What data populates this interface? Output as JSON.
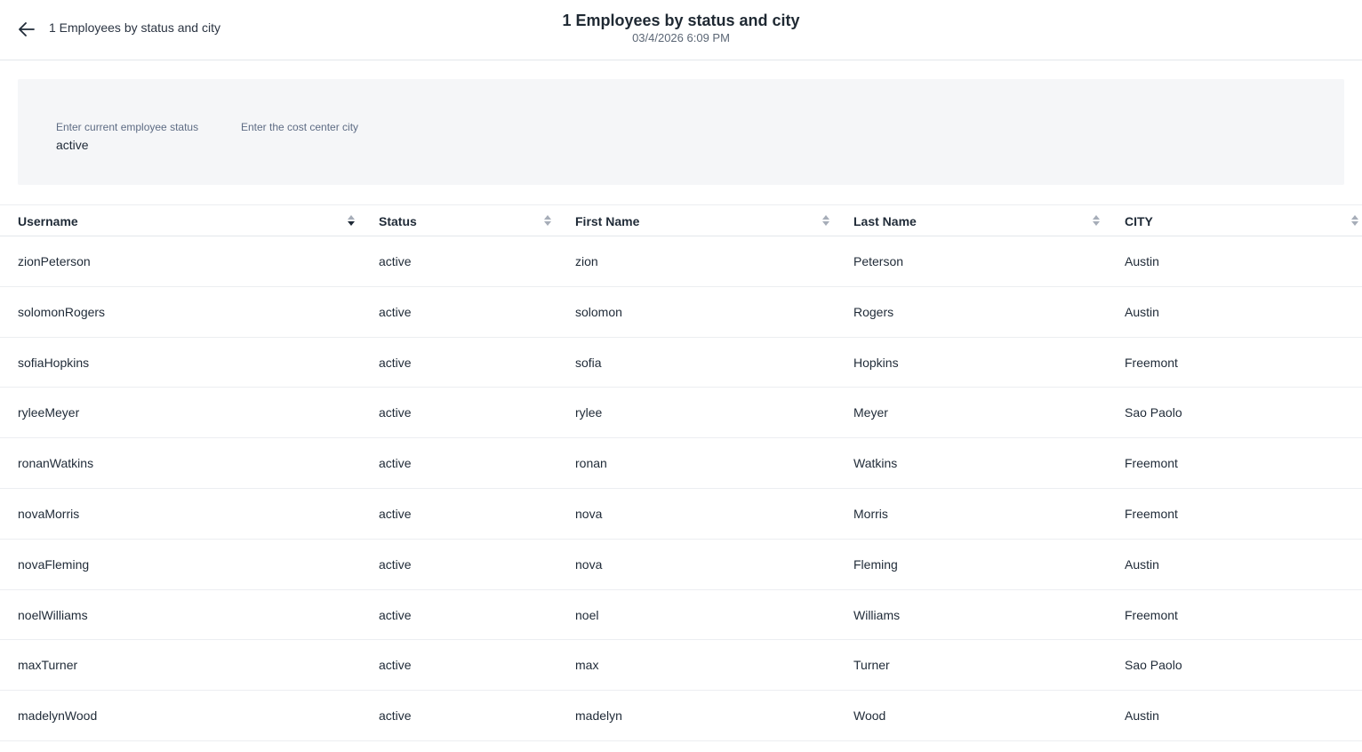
{
  "header": {
    "breadcrumb": "1 Employees by status and city",
    "title": "1 Employees by status and city",
    "timestamp": "03/4/2026 6:09 PM",
    "back_icon": "arrow-left-icon"
  },
  "filters": [
    {
      "label": "Enter current employee status",
      "value": "active"
    },
    {
      "label": "Enter the cost center city",
      "value": ""
    }
  ],
  "table": {
    "columns": [
      "Username",
      "Status",
      "First Name",
      "Last Name",
      "CITY"
    ],
    "sorted_column": "Username",
    "sort_direction": "descending",
    "rows": [
      [
        "zionPeterson",
        "active",
        "zion",
        "Peterson",
        "Austin"
      ],
      [
        "solomonRogers",
        "active",
        "solomon",
        "Rogers",
        "Austin"
      ],
      [
        "sofiaHopkins",
        "active",
        "sofia",
        "Hopkins",
        "Freemont"
      ],
      [
        "ryleeMeyer",
        "active",
        "rylee",
        "Meyer",
        "Sao Paolo"
      ],
      [
        "ronanWatkins",
        "active",
        "ronan",
        "Watkins",
        "Freemont"
      ],
      [
        "novaMorris",
        "active",
        "nova",
        "Morris",
        "Freemont"
      ],
      [
        "novaFleming",
        "active",
        "nova",
        "Fleming",
        "Austin"
      ],
      [
        "noelWilliams",
        "active",
        "noel",
        "Williams",
        "Freemont"
      ],
      [
        "maxTurner",
        "active",
        "max",
        "Turner",
        "Sao Paolo"
      ],
      [
        "madelynWood",
        "active",
        "madelyn",
        "Wood",
        "Austin"
      ]
    ]
  },
  "colors": {
    "filter_bg": "#f5f6f8",
    "border": "#e3e6ea",
    "text": "#1f2a37",
    "muted": "#5e6c84",
    "sort_inactive": "#a6adb8",
    "sort_active": "#1f2a37"
  }
}
